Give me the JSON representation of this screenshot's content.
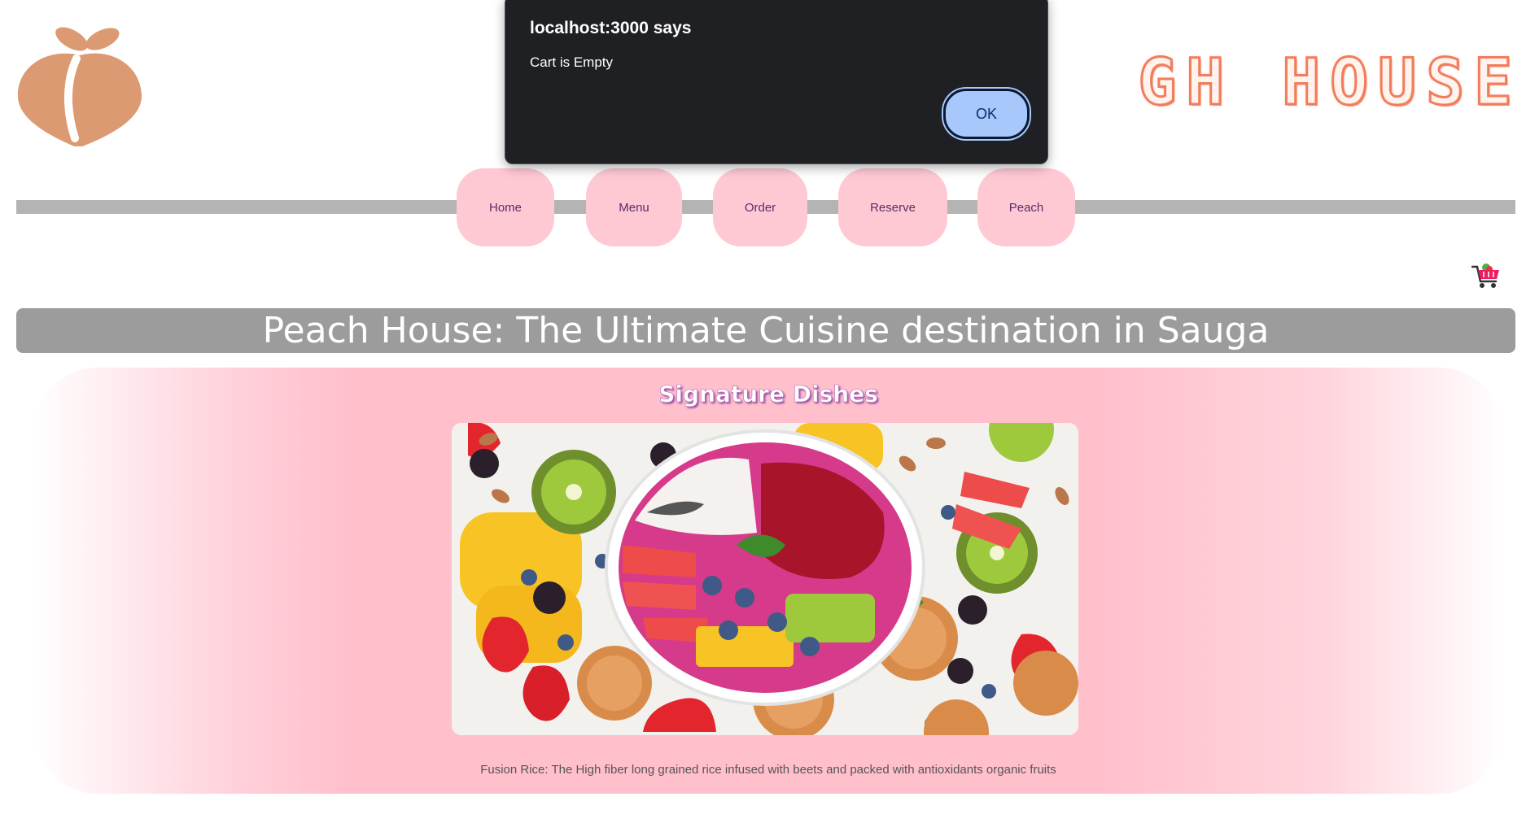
{
  "brand": {
    "logo": "peach-logo",
    "title_visible": "GH HOUSE",
    "title_color": "#f27d5c"
  },
  "nav": {
    "items": [
      {
        "label": "Home"
      },
      {
        "label": "Menu"
      },
      {
        "label": "Order"
      },
      {
        "label": "Reserve"
      },
      {
        "label": "Peach"
      }
    ],
    "button_color": "#ffc9d4",
    "bar_color": "#b4b4b4"
  },
  "cart": {
    "icon": "shopping-cart-icon"
  },
  "headline": {
    "text": "Peach House: The Ultimate Cuisine destination in Sauga",
    "bg_color": "#9c9c9c"
  },
  "signature": {
    "title": "Signature Dishes",
    "image": "fruit-bowl-photo",
    "caption": "Fusion Rice: The High fiber long grained rice infused with beets and packed with antioxidants organic fruits",
    "bg_color": "#ffbfcb"
  },
  "alert": {
    "title": "localhost:3000 says",
    "message": "Cart is Empty",
    "ok_label": "OK",
    "ok_color": "#a8c7fa"
  }
}
